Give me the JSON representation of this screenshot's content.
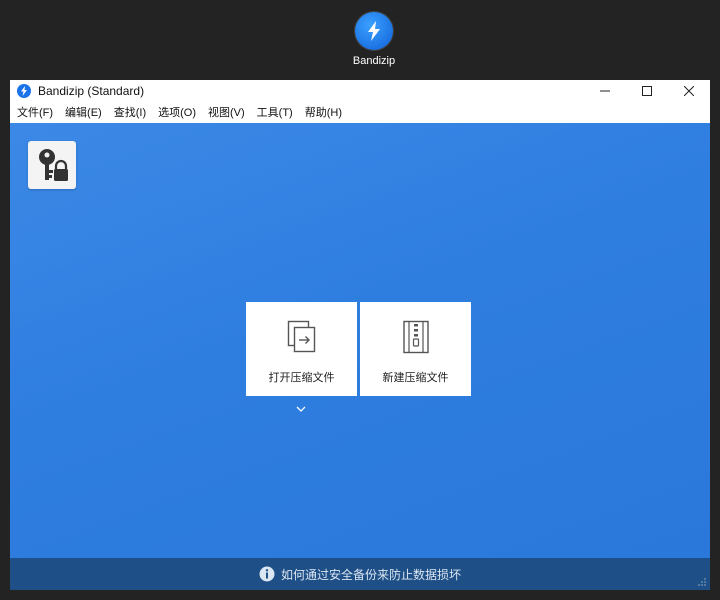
{
  "desktop": {
    "icon_label": "Bandizip"
  },
  "window": {
    "title": "Bandizip (Standard)"
  },
  "menu": [
    "文件(F)",
    "编辑(E)",
    "查找(I)",
    "选项(O)",
    "视图(V)",
    "工具(T)",
    "帮助(H)"
  ],
  "actions": {
    "open_label": "打开压缩文件",
    "new_label": "新建压缩文件"
  },
  "info": {
    "text": "如何通过安全备份来防止数据损坏"
  },
  "colors": {
    "content_bg": "#2e7ee0",
    "info_bg": "#1e4f86",
    "brand": "#1a73e8"
  }
}
